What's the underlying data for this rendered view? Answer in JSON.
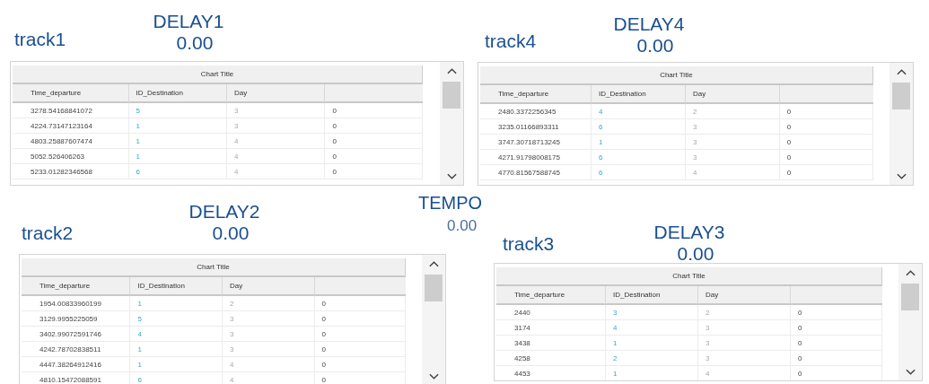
{
  "panels": [
    {
      "track": "track1",
      "delay": {
        "label": "DELAY1",
        "value": "0.00"
      },
      "table": {
        "title": "Chart Title",
        "columns": [
          "Time_departure",
          "ID_Destination",
          "Day"
        ],
        "rows": [
          [
            "3278.54168841072",
            "5",
            "3",
            "0"
          ],
          [
            "4224.73147123164",
            "1",
            "3",
            "0"
          ],
          [
            "4803.25887607474",
            "1",
            "4",
            "0"
          ],
          [
            "5052.526406263",
            "1",
            "4",
            "0"
          ],
          [
            "5233.01282346568",
            "6",
            "4",
            "0"
          ]
        ]
      }
    },
    {
      "track": "track4",
      "delay": {
        "label": "DELAY4",
        "value": "0.00"
      },
      "table": {
        "title": "Chart Title",
        "columns": [
          "Time_departure",
          "ID_Destination",
          "Day"
        ],
        "rows": [
          [
            "2480.3372256345",
            "4",
            "2",
            "0"
          ],
          [
            "3235.01166893311",
            "6",
            "3",
            "0"
          ],
          [
            "3747.30718713245",
            "1",
            "3",
            "0"
          ],
          [
            "4271.91798008175",
            "6",
            "3",
            "0"
          ],
          [
            "4770.81567588745",
            "6",
            "4",
            "0"
          ]
        ]
      }
    },
    {
      "track": "track2",
      "delay": {
        "label": "DELAY2",
        "value": "0.00"
      },
      "table": {
        "title": "Chart Title",
        "columns": [
          "Time_departure",
          "ID_Destination",
          "Day"
        ],
        "rows": [
          [
            "1954.00833960199",
            "1",
            "2",
            "0"
          ],
          [
            "3129.9955225059",
            "5",
            "3",
            "0"
          ],
          [
            "3402.99072591746",
            "4",
            "3",
            "0"
          ],
          [
            "4242.78702838511",
            "1",
            "3",
            "0"
          ],
          [
            "4447.38264912416",
            "1",
            "4",
            "0"
          ],
          [
            "4810.15472088591",
            "6",
            "4",
            "0"
          ]
        ]
      }
    },
    {
      "track": "track3",
      "delay": {
        "label": "DELAY3",
        "value": "0.00"
      },
      "table": {
        "title": "Chart Title",
        "columns": [
          "Time_departure",
          "ID_Destination",
          "Day"
        ],
        "rows": [
          [
            "2440",
            "3",
            "2",
            "0"
          ],
          [
            "3174",
            "4",
            "3",
            "0"
          ],
          [
            "3438",
            "1",
            "3",
            "0"
          ],
          [
            "4258",
            "2",
            "3",
            "0"
          ],
          [
            "4453",
            "1",
            "4",
            "0"
          ]
        ]
      }
    }
  ],
  "tempo": {
    "label": "TEMPO",
    "value": "0.00"
  }
}
